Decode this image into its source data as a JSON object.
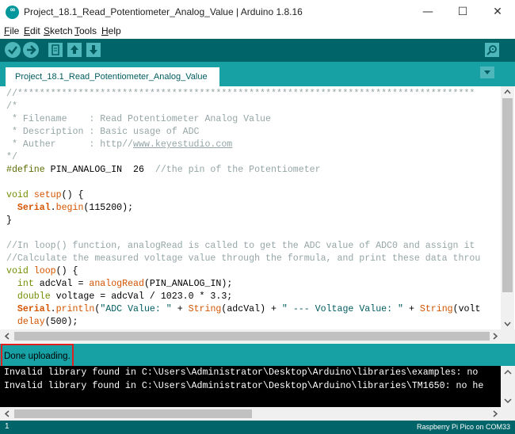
{
  "window": {
    "title": "Project_18.1_Read_Potentiometer_Analog_Value | Arduino 1.8.16",
    "icon": "arduino-logo-icon",
    "minimize": "—",
    "maximize": "☐",
    "close": "✕"
  },
  "menu": [
    {
      "accel": "F",
      "rest": "ile"
    },
    {
      "accel": "E",
      "rest": "dit"
    },
    {
      "accel": "S",
      "rest": "ketch"
    },
    {
      "accel": "T",
      "rest": "ools"
    },
    {
      "accel": "H",
      "rest": "elp"
    }
  ],
  "toolbar": {
    "verify": "verify-check-icon",
    "upload": "upload-arrow-icon",
    "new": "new-file-icon",
    "open": "open-up-arrow-icon",
    "save": "save-down-arrow-icon",
    "serial_monitor": "serial-monitor-magnifier-icon"
  },
  "tab": {
    "label": "Project_18.1_Read_Potentiometer_Analog_Value",
    "menu_icon": "tab-menu-down-icon"
  },
  "code": {
    "l1": "//***********************************************************************************",
    "l2": "/*",
    "l3": " * Filename    : Read Potentiometer Analog Value",
    "l4": " * Description : Basic usage of ADC",
    "l5_a": " * Auther      : http//",
    "l5_link": "www.keyestudio.com",
    "l6": "*/",
    "l7_kw": "#define",
    "l7_rest": " PIN_ANALOG_IN  26  ",
    "l7_cm": "//the pin of the Potentiometer",
    "l9_kw": "void",
    "l9_fn": "setup",
    "l9_rest": "() {",
    "l10_a": "  ",
    "l10_obj": "Serial",
    "l10_dot": ".",
    "l10_fn": "begin",
    "l10_rest": "(115200);",
    "l11": "}",
    "l13": "//In loop() function, analogRead is called to get the ADC value of ADC0 and assign it",
    "l14": "//Calculate the measured voltage value through the formula, and print these data throu",
    "l15_kw": "void",
    "l15_fn": "loop",
    "l15_rest": "() {",
    "l16_a": "  ",
    "l16_kw": "int",
    "l16_b": " adcVal = ",
    "l16_fn": "analogRead",
    "l16_c": "(PIN_ANALOG_IN);",
    "l17_a": "  ",
    "l17_kw": "double",
    "l17_b": " voltage = adcVal / 1023.0 * 3.3;",
    "l18_a": "  ",
    "l18_obj": "Serial",
    "l18_dot": ".",
    "l18_fn": "println",
    "l18_b": "(",
    "l18_s1": "\"ADC Value: \"",
    "l18_c": " + ",
    "l18_str": "String",
    "l18_d": "(adcVal) + ",
    "l18_s2": "\" --- Voltage Value: \"",
    "l18_e": " + ",
    "l18_str2": "String",
    "l18_f": "(volt",
    "l19_a": "  ",
    "l19_fn": "delay",
    "l19_b": "(500);"
  },
  "status": {
    "message": "Done uploading."
  },
  "console": {
    "lines": [
      "Invalid library found in C:\\Users\\Administrator\\Desktop\\Arduino\\libraries\\examples: no",
      "Invalid library found in C:\\Users\\Administrator\\Desktop\\Arduino\\libraries\\TM1650: no he"
    ]
  },
  "footer": {
    "line_number": "1",
    "board": "Raspberry Pi Pico on COM33"
  },
  "colors": {
    "toolbar": "#006468",
    "tabstrip": "#17a1a5",
    "highlight": "#e02020"
  }
}
